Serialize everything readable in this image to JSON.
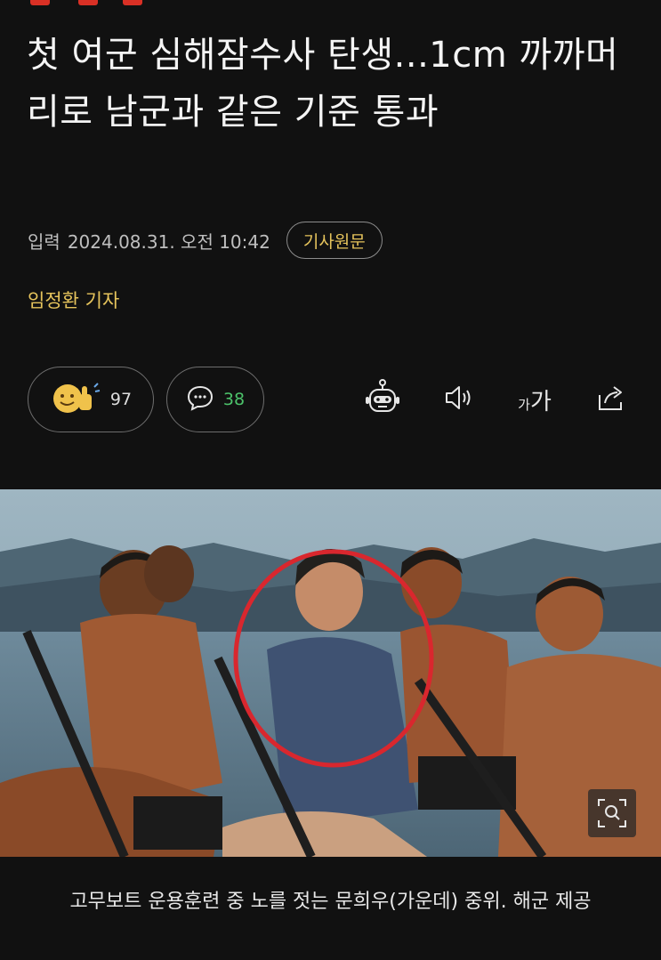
{
  "headline": "첫 여군 심해잠수사 탄생...1cm 까까머리로 남군과 같은 기준 통과",
  "meta": {
    "input_label": "입력",
    "datetime": "2024.08.31. 오전 10:42",
    "source_button": "기사원문"
  },
  "reporter": "임정환 기자",
  "reactions": {
    "reaction_count": "97",
    "comment_count": "38"
  },
  "toolbar": {
    "font_small": "가",
    "font_big": "가"
  },
  "photo": {
    "caption": "고무보트 운용훈련 중 노를 젓는 문희우(가운데) 중위. 해군 제공"
  },
  "colors": {
    "accent": "#e6c45c",
    "comment_count": "#4cc26a",
    "highlight_circle": "#d9272e",
    "background": "#111111"
  },
  "icons": [
    "emoji-reaction-icon",
    "comment-icon",
    "ai-robot-icon",
    "speaker-icon",
    "font-size-icon",
    "share-icon",
    "zoom-icon"
  ]
}
